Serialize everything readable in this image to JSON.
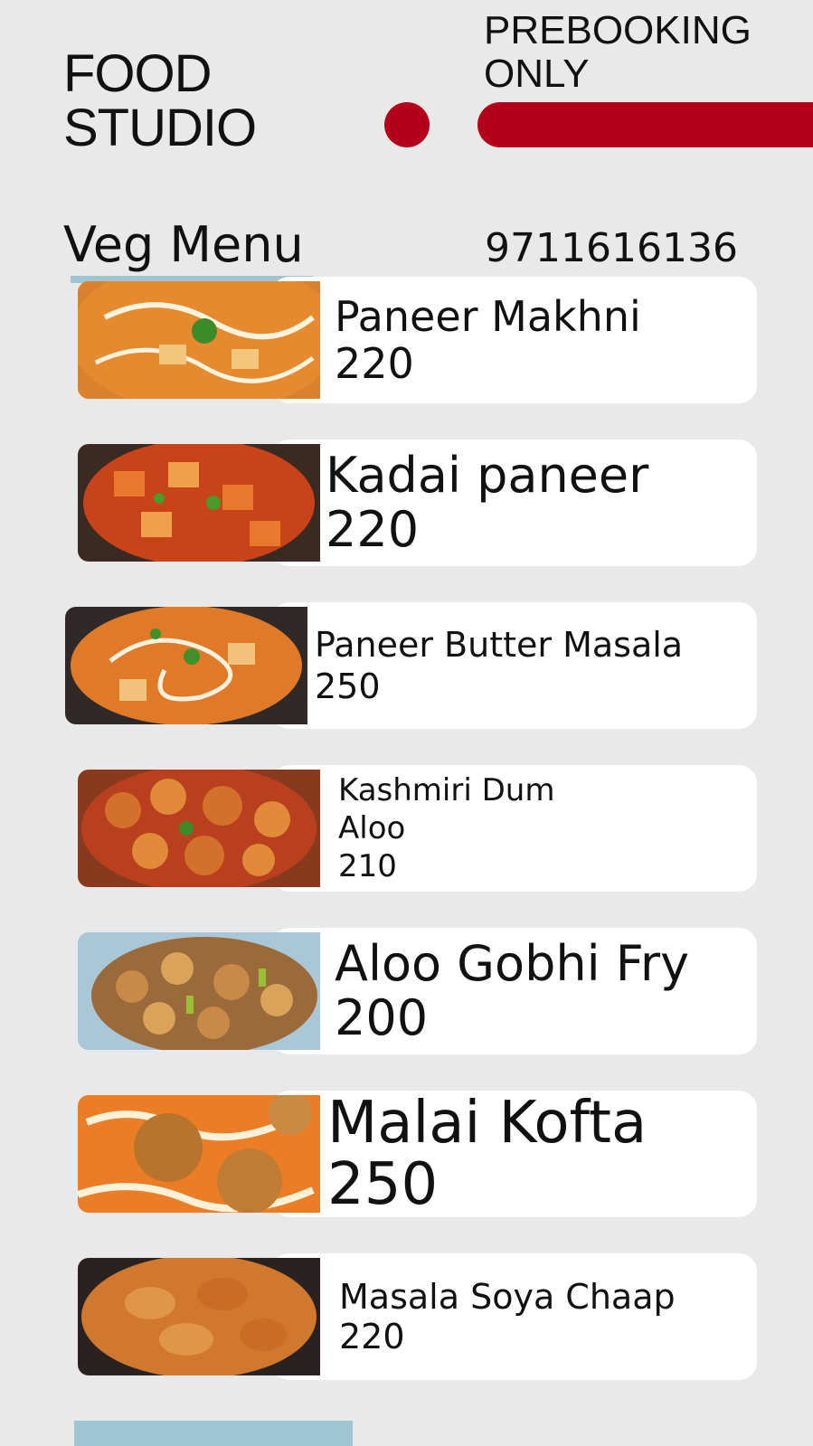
{
  "header": {
    "brand_line1": "FOOD",
    "brand_line2": "STUDIO",
    "prebook_line1": "PREBOOKING",
    "prebook_line2": "ONLY",
    "menu_title": "Veg Menu",
    "phone": "9711616136"
  },
  "colors": {
    "accent": "#b5001c",
    "background": "#e9e9e9",
    "card": "#ffffff",
    "strip": "#9fc5d3"
  },
  "items": [
    {
      "lines": [
        "Paneer Makhni",
        "220"
      ],
      "image": "paneer-makhni-image"
    },
    {
      "lines": [
        "Kadai paneer",
        "220"
      ],
      "image": "kadai-paneer-image"
    },
    {
      "lines": [
        "Paneer Butter Masala",
        "250"
      ],
      "image": "paneer-butter-masala-image"
    },
    {
      "lines": [
        "Kashmiri Dum",
        "Aloo",
        "210"
      ],
      "image": "kashmiri-dum-aloo-image"
    },
    {
      "lines": [
        "Aloo Gobhi Fry",
        "200"
      ],
      "image": "aloo-gobhi-fry-image"
    },
    {
      "lines": [
        "Malai Kofta",
        "250"
      ],
      "image": "malai-kofta-image"
    },
    {
      "lines": [
        "Masala Soya Chaap",
        "220"
      ],
      "image": "masala-soya-chaap-image"
    }
  ]
}
